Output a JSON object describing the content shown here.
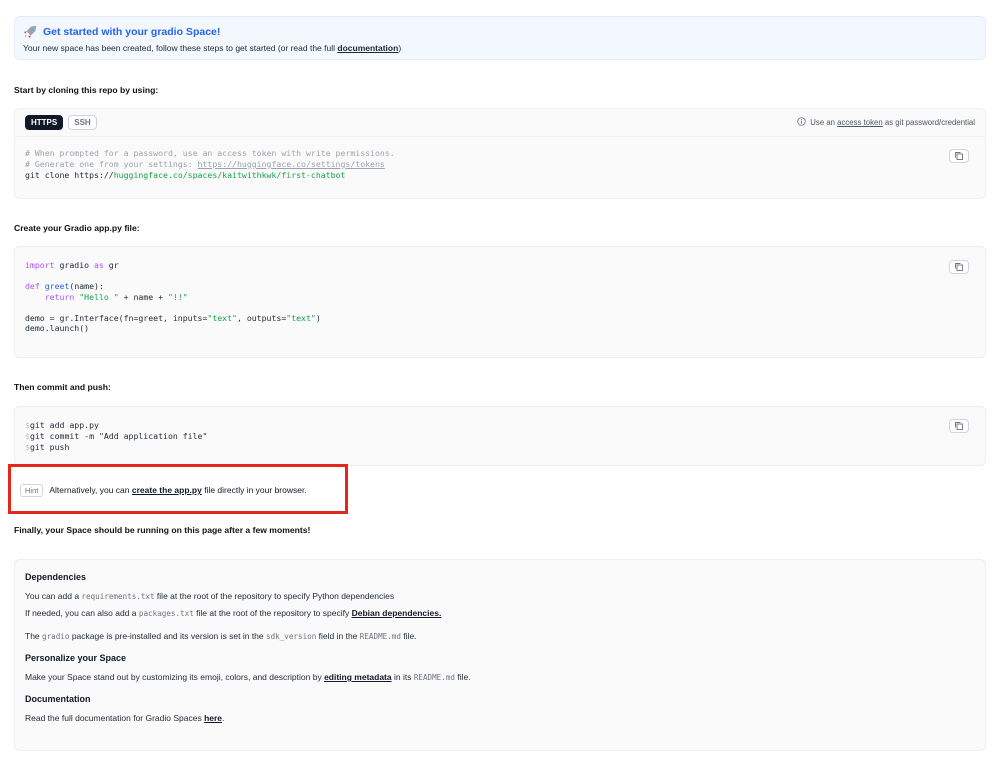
{
  "banner": {
    "title": "Get started with your gradio Space!",
    "subtitle_pre": "Your new space has been created, follow these steps to get started (or read the full ",
    "subtitle_link": "documentation",
    "subtitle_post": ")",
    "icon": "rocket-icon"
  },
  "clone": {
    "heading": "Start by cloning this repo by using:",
    "tabs": [
      "HTTPS",
      "SSH"
    ],
    "active_tab": "HTTPS",
    "note_pre": "Use an ",
    "note_link": "access token",
    "note_post": " as git password/credential",
    "line1": "# When prompted for a password, use an access token with write permissions.",
    "line2_pre": "# Generate one from your settings: ",
    "line2_link": "https://huggingface.co/settings/tokens",
    "line3_pre": "git clone https://",
    "line3_url": "huggingface.co/spaces/kaitwithkwk/first-chatbot"
  },
  "create": {
    "heading": "Create your Gradio app.py file:",
    "l1_kw": "import",
    "l1_a": " gradio ",
    "l1_as": "as",
    "l1_b": " gr",
    "l2_kw": "def",
    "l2_fn": "greet",
    "l2_rest": "(name):",
    "l3_indent": "    ",
    "l3_kw": "return",
    "l3_str1": "\"Hello \"",
    "l3_mid": " + name + ",
    "l3_str2": "\"!!\"",
    "l4_a": "demo = gr.Interface(fn=greet, inputs=",
    "l4_s1": "\"text\"",
    "l4_b": ", outputs=",
    "l4_s2": "\"text\"",
    "l4_c": ")",
    "l5": "demo.launch()"
  },
  "commit": {
    "heading": "Then commit and push:",
    "prompt": "$",
    "lines": [
      "git add app.py",
      "git commit -m \"Add application file\"",
      "git push"
    ]
  },
  "hint": {
    "badge": "Hint",
    "pre": "Alternatively, you can ",
    "link": "create the app.py",
    "post": " file directly in your browser."
  },
  "final": {
    "heading": "Finally, your Space should be running on this page after a few moments!",
    "dep_title": "Dependencies",
    "dep1_pre": "You can add a ",
    "dep1_code": "requirements.txt",
    "dep1_post": " file at the root of the repository to specify Python dependencies",
    "dep2_pre": "If needed, you can also add a ",
    "dep2_code": "packages.txt",
    "dep2_mid": " file at the root of the repository to specify ",
    "dep2_link": "Debian dependencies.",
    "dep3_pre": "The ",
    "dep3_code1": "gradio",
    "dep3_mid": " package is pre-installed and its version is set in the ",
    "dep3_code2": "sdk_version",
    "dep3_mid2": " field in the ",
    "dep3_code3": "README.md",
    "dep3_post": " file.",
    "pers_title": "Personalize your Space",
    "pers_pre": "Make your Space stand out by customizing its emoji, colors, and description by ",
    "pers_link": "editing metadata",
    "pers_mid": " in its ",
    "pers_code": "README.md",
    "pers_post": " file.",
    "doc_title": "Documentation",
    "doc_pre": "Read the full documentation for Gradio Spaces ",
    "doc_link": "here",
    "doc_post": "."
  },
  "colors": {
    "accent": "#2563eb",
    "highlight": "#e5261d",
    "string": "#16a34a",
    "keyword": "#a855f7"
  }
}
